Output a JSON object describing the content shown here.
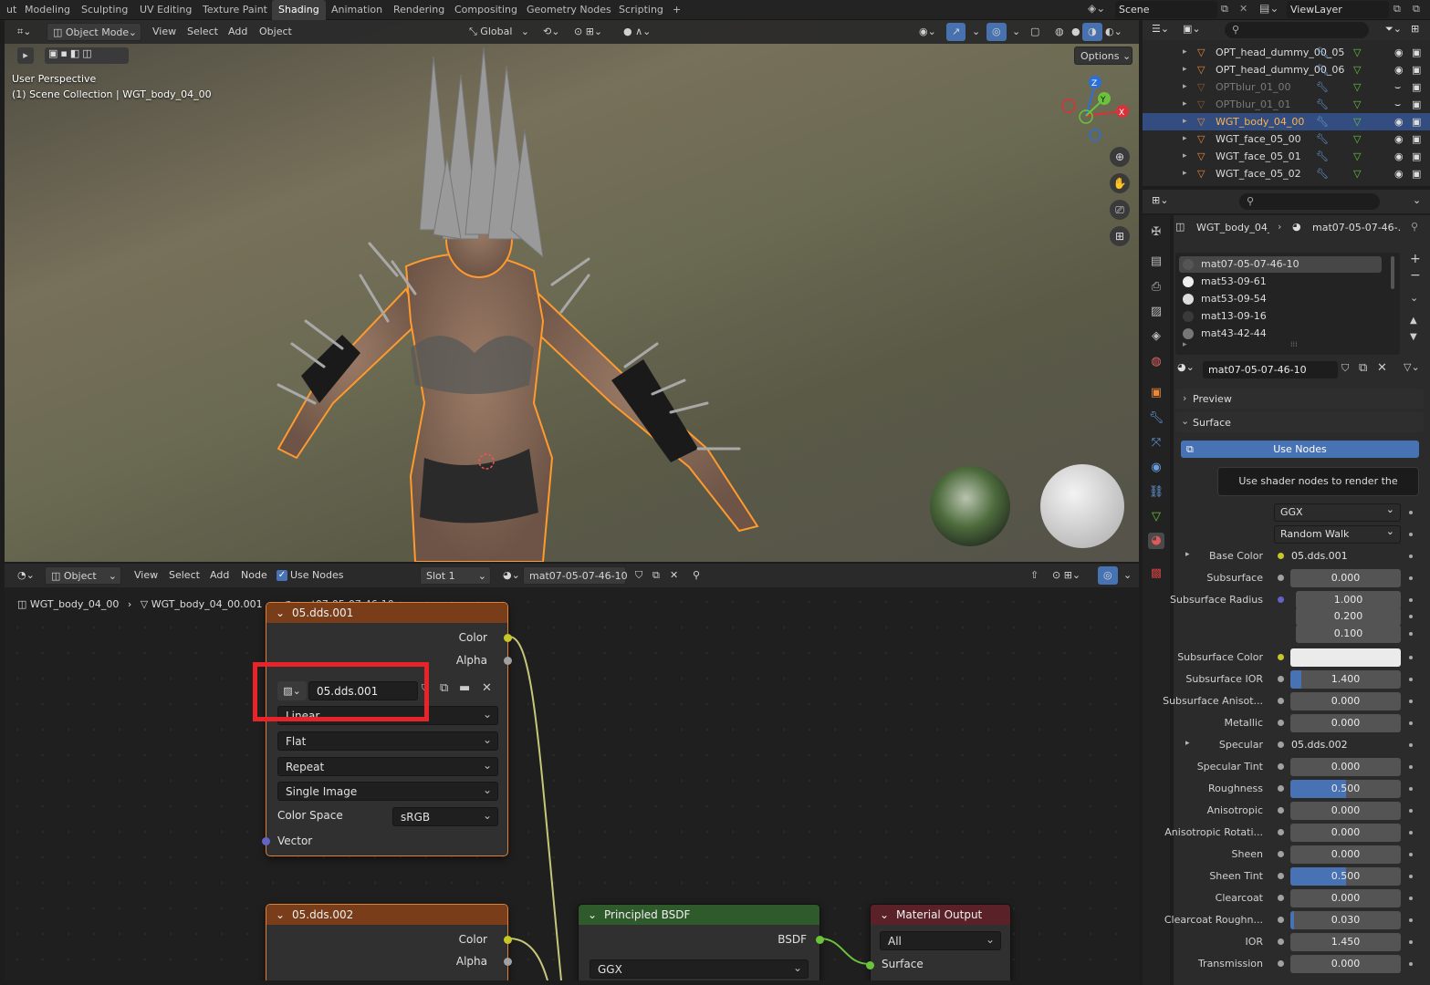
{
  "workspaces": [
    "ut",
    "Modeling",
    "Sculpting",
    "UV Editing",
    "Texture Paint",
    "Shading",
    "Animation",
    "Rendering",
    "Compositing",
    "Geometry Nodes",
    "Scripting"
  ],
  "active_workspace": "Shading",
  "add_workspace": "+",
  "scene": {
    "name": "Scene",
    "view_layer": "ViewLayer"
  },
  "viewport": {
    "mode": "Object Mode",
    "menus": [
      "View",
      "Select",
      "Add",
      "Object"
    ],
    "transform": "Global",
    "options": "Options",
    "overlay_line1": "User Perspective",
    "overlay_line2": "(1) Scene Collection | WGT_body_04_00",
    "gizmo": {
      "x": "X",
      "y": "Y",
      "z": "Z"
    }
  },
  "node_editor": {
    "type": "Object",
    "menus": [
      "View",
      "Select",
      "Add",
      "Node"
    ],
    "use_nodes": "Use Nodes",
    "slot": "Slot 1",
    "material": "mat07-05-07-46-10",
    "breadcrumb": [
      "WGT_body_04_00",
      "WGT_body_04_00.001",
      "mat07-05-07-46-10"
    ],
    "node_image1": {
      "title": "05.dds.001",
      "out_color": "Color",
      "out_alpha": "Alpha",
      "image_name": "05.dds.001",
      "interp": "Linear",
      "projection": "Flat",
      "extension": "Repeat",
      "source": "Single Image",
      "colorspace_label": "Color Space",
      "colorspace": "sRGB",
      "in_vector": "Vector"
    },
    "node_image2": {
      "title": "05.dds.002",
      "out_color": "Color",
      "out_alpha": "Alpha"
    },
    "node_bsdf": {
      "title": "Principled BSDF",
      "out": "BSDF",
      "distribution": "GGX"
    },
    "node_output": {
      "title": "Material Output",
      "target": "All",
      "in_surface": "Surface"
    },
    "highlight_color": "#e8232a"
  },
  "outliner": {
    "rows": [
      {
        "name": "OPT_head_dummy_00_05",
        "state": "normal"
      },
      {
        "name": "OPT_head_dummy_00_06",
        "state": "normal"
      },
      {
        "name": "OPTblur_01_00",
        "state": "dim"
      },
      {
        "name": "OPTblur_01_01",
        "state": "dim"
      },
      {
        "name": "WGT_body_04_00",
        "state": "selected"
      },
      {
        "name": "WGT_face_05_00",
        "state": "normal"
      },
      {
        "name": "WGT_face_05_01",
        "state": "normal"
      },
      {
        "name": "WGT_face_05_02",
        "state": "normal"
      }
    ]
  },
  "properties": {
    "breadcrumb_obj": "WGT_body_04_...",
    "breadcrumb_mat": "mat07-05-07-46-...",
    "slots": [
      "mat07-05-07-46-10",
      "mat53-09-61",
      "mat53-09-54",
      "mat13-09-16",
      "mat43-42-44"
    ],
    "active_material": "mat07-05-07-46-10",
    "preview": "Preview",
    "surface": "Surface",
    "use_nodes": "Use Nodes",
    "tooltip": "Use shader nodes to render the material.",
    "distribution": "GGX",
    "subsurface_method": "Random Walk",
    "fields": [
      {
        "label": "Base Color",
        "value": "05.dds.001",
        "kind": "link",
        "dot": "#c7c729"
      },
      {
        "label": "Subsurface",
        "value": "0.000",
        "kind": "num",
        "fill": 0
      },
      {
        "label": "Subsurface Radius",
        "value": "1.000",
        "kind": "num",
        "fill": 0,
        "dot": "#6363c7"
      },
      {
        "label": "",
        "value": "0.200",
        "kind": "num",
        "fill": 0
      },
      {
        "label": "",
        "value": "0.100",
        "kind": "num",
        "fill": 0
      },
      {
        "label": "Subsurface Color",
        "value": "",
        "kind": "color",
        "dot": "#c7c729"
      },
      {
        "label": "Subsurface IOR",
        "value": "1.400",
        "kind": "num",
        "fill": 0.1
      },
      {
        "label": "Subsurface Anisot...",
        "value": "0.000",
        "kind": "num",
        "fill": 0
      },
      {
        "label": "Metallic",
        "value": "0.000",
        "kind": "num",
        "fill": 0
      },
      {
        "label": "Specular",
        "value": "05.dds.002",
        "kind": "link",
        "dot": "#a1a1a1"
      },
      {
        "label": "Specular Tint",
        "value": "0.000",
        "kind": "num",
        "fill": 0
      },
      {
        "label": "Roughness",
        "value": "0.500",
        "kind": "num",
        "fill": 0.5
      },
      {
        "label": "Anisotropic",
        "value": "0.000",
        "kind": "num",
        "fill": 0
      },
      {
        "label": "Anisotropic Rotati...",
        "value": "0.000",
        "kind": "num",
        "fill": 0
      },
      {
        "label": "Sheen",
        "value": "0.000",
        "kind": "num",
        "fill": 0
      },
      {
        "label": "Sheen Tint",
        "value": "0.500",
        "kind": "num",
        "fill": 0.5
      },
      {
        "label": "Clearcoat",
        "value": "0.000",
        "kind": "num",
        "fill": 0
      },
      {
        "label": "Clearcoat Roughn...",
        "value": "0.030",
        "kind": "num",
        "fill": 0.03
      },
      {
        "label": "IOR",
        "value": "1.450",
        "kind": "num",
        "fill": 0
      },
      {
        "label": "Transmission",
        "value": "0.000",
        "kind": "num",
        "fill": 0
      }
    ]
  }
}
